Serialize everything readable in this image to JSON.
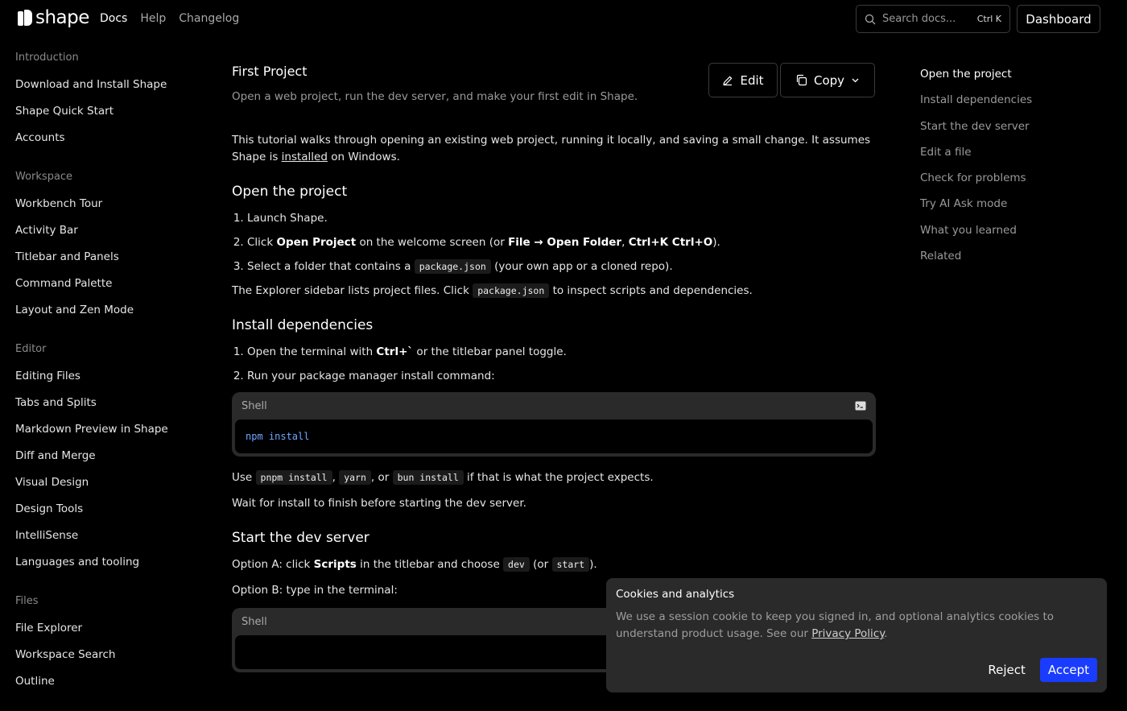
{
  "header": {
    "logo_text": "shape",
    "nav": [
      {
        "label": "Docs",
        "active": true
      },
      {
        "label": "Help",
        "active": false
      },
      {
        "label": "Changelog",
        "active": false
      }
    ],
    "search_placeholder": "Search docs...",
    "search_shortcut": "Ctrl K",
    "dashboard_label": "Dashboard"
  },
  "sidebar": {
    "groups": [
      {
        "heading": "Introduction",
        "items": [
          "Download and Install Shape",
          "Shape Quick Start",
          "Accounts"
        ]
      },
      {
        "heading": "Workspace",
        "items": [
          "Workbench Tour",
          "Activity Bar",
          "Titlebar and Panels",
          "Command Palette",
          "Layout and Zen Mode"
        ]
      },
      {
        "heading": "Editor",
        "items": [
          "Editing Files",
          "Tabs and Splits",
          "Markdown Preview in Shape",
          "Diff and Merge",
          "Visual Design",
          "Design Tools",
          "IntelliSense",
          "Languages and tooling"
        ]
      },
      {
        "heading": "Files",
        "items": [
          "File Explorer",
          "Workspace Search",
          "Outline"
        ]
      }
    ]
  },
  "page": {
    "title": "First Project",
    "subtitle": "Open a web project, run the dev server, and make your first edit in Shape.",
    "edit_label": "Edit",
    "copy_label": "Copy",
    "intro_before": "This tutorial walks through opening an existing web project, running it locally, and saving a small change. It assumes Shape is ",
    "intro_link": "installed",
    "intro_after": " on Windows.",
    "s1_heading": "Open the project",
    "s1_step1": "Launch Shape.",
    "s1_step2_a": "Click ",
    "s1_step2_b": "Open Project",
    "s1_step2_c": " on the welcome screen (or ",
    "s1_step2_d": "File → Open Folder",
    "s1_step2_e": ", ",
    "s1_step2_f": "Ctrl+K Ctrl+O",
    "s1_step2_g": ").",
    "s1_step3_a": "Select a folder that contains a ",
    "s1_step3_code": "package.json",
    "s1_step3_b": " (your own app or a cloned repo).",
    "s1_para_a": "The Explorer sidebar lists project files. Click ",
    "s1_para_code": "package.json",
    "s1_para_b": " to inspect scripts and dependencies.",
    "s2_heading": "Install dependencies",
    "s2_step1_a": "Open the terminal with ",
    "s2_step1_b": "Ctrl+`",
    "s2_step1_c": " or the titlebar panel toggle.",
    "s2_step2": "Run your package manager install command:",
    "code1_lang": "Shell",
    "code1_body": "npm install",
    "s2_para_a": "Use ",
    "s2_code_a": "pnpm install",
    "s2_para_b": ", ",
    "s2_code_b": "yarn",
    "s2_para_c": ", or ",
    "s2_code_c": "bun install",
    "s2_para_d": " if that is what the project expects.",
    "s2_para2": "Wait for install to finish before starting the dev server.",
    "s3_heading": "Start the dev server",
    "s3_a_a": "Option A: click ",
    "s3_a_b": "Scripts",
    "s3_a_c": " in the titlebar and choose ",
    "s3_a_code1": "dev",
    "s3_a_d": " (or ",
    "s3_a_code2": "start",
    "s3_a_e": ").",
    "s3_b": "Option B: type in the terminal:",
    "code2_lang": "Shell"
  },
  "toc": [
    "Open the project",
    "Install dependencies",
    "Start the dev server",
    "Edit a file",
    "Check for problems",
    "Try AI Ask mode",
    "What you learned",
    "Related"
  ],
  "cookie": {
    "title": "Cookies and analytics",
    "text_before": "We use a session cookie to keep you signed in, and optional analytics cookies to understand product usage. See our ",
    "link": "Privacy Policy",
    "text_after": ".",
    "reject_label": "Reject",
    "accept_label": "Accept"
  },
  "colors": {
    "accent": "#1a3cff",
    "code_text": "#6ea8ff"
  }
}
